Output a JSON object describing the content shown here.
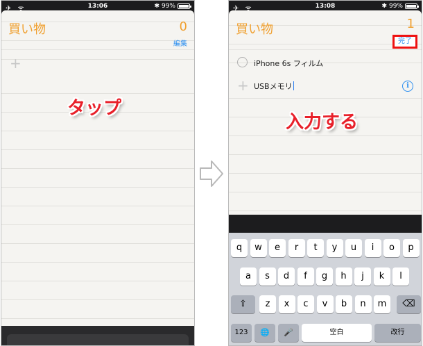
{
  "left": {
    "status": {
      "left_icons": "✈ ᯤ",
      "time": "13:06",
      "bt": "✱",
      "battery_text": "99%",
      "battery_level": 0.99
    },
    "list_title": "買い物",
    "count": "0",
    "edit_label": "編集",
    "add_icon": "+",
    "callout": "タップ"
  },
  "right": {
    "status": {
      "left_icons": "✈ ᯤ",
      "time": "13:08",
      "bt": "✱",
      "battery_text": "99%",
      "battery_level": 0.99
    },
    "list_title": "買い物",
    "count": "1",
    "done_label": "完了",
    "items": [
      "iPhone 6s フィルム"
    ],
    "add_icon": "+",
    "input_value": "USBメモリ",
    "info_icon": "i",
    "callout": "入力する",
    "keyboard": {
      "row1": [
        "q",
        "w",
        "e",
        "r",
        "t",
        "y",
        "u",
        "i",
        "o",
        "p"
      ],
      "row2": [
        "a",
        "s",
        "d",
        "f",
        "g",
        "h",
        "j",
        "k",
        "l"
      ],
      "row3": [
        "z",
        "x",
        "c",
        "v",
        "b",
        "n",
        "m"
      ],
      "shift_icon": "⇧",
      "delete_icon": "⌫",
      "numbers_label": "123",
      "globe_icon": "🌐",
      "mic_icon": "🎤",
      "space_label": "空白",
      "return_label": "改行"
    }
  },
  "colors": {
    "accent_orange": "#f0a030",
    "link_blue": "#2b8ef0",
    "callout_red": "#e8202a",
    "highlight_red": "#e11111"
  }
}
